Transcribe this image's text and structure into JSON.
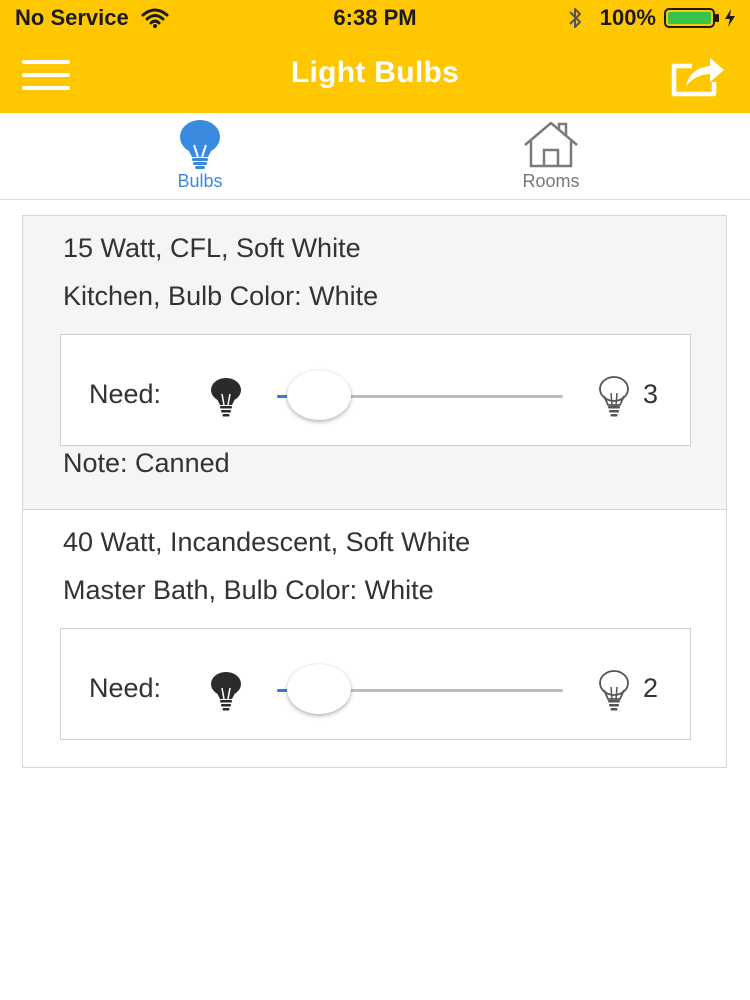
{
  "status_bar": {
    "carrier": "No Service",
    "time": "6:38 PM",
    "battery": "100%"
  },
  "nav": {
    "title": "Light Bulbs"
  },
  "tabs": [
    {
      "label": "Bulbs",
      "icon": "lightbulb-icon",
      "selected": true
    },
    {
      "label": "Rooms",
      "icon": "house-icon",
      "selected": false
    }
  ],
  "items": [
    {
      "description": "15 Watt, CFL, Soft White",
      "location": "Kitchen, Bulb Color: White",
      "need_label": "Need:",
      "need_count": "3",
      "slider_value_fraction": 0.0,
      "note": "Note: Canned"
    },
    {
      "description": "40 Watt, Incandescent, Soft White",
      "location": "Master Bath, Bulb Color: White",
      "need_label": "Need:",
      "need_count": "2",
      "slider_value_fraction": 0.0
    }
  ],
  "colors": {
    "brand_yellow": "#FFC700",
    "accent_blue": "#3A8BE0",
    "slider_blue": "#2F7DE1"
  }
}
